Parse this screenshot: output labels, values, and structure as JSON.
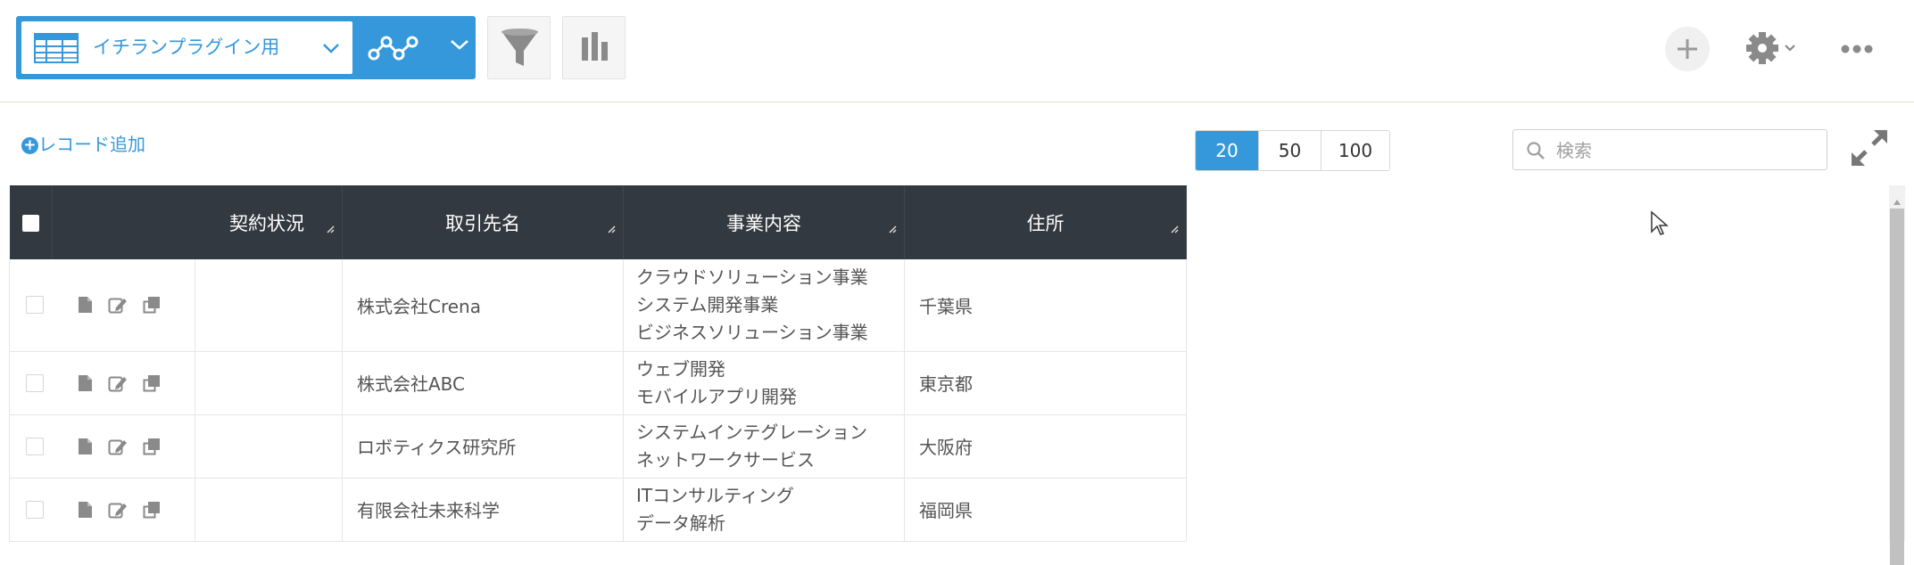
{
  "header": {
    "view_name": "イチランプラグイン用",
    "icons": [
      "table-icon",
      "chevron-down-icon",
      "graph-line-icon",
      "filter-icon",
      "bar-chart-icon",
      "plus-icon",
      "gear-icon",
      "more-icon"
    ]
  },
  "toolbar": {
    "add_record_label": "レコード追加",
    "page_sizes": [
      "20",
      "50",
      "100"
    ],
    "active_page_size": "20",
    "search_placeholder": "検索"
  },
  "table": {
    "columns": [
      "契約状況",
      "取引先名",
      "事業内容",
      "住所"
    ],
    "rows": [
      {
        "status": "",
        "company": "株式会社Crena",
        "business": [
          "クラウドソリューション事業",
          "システム開発事業",
          "ビジネスソリューション事業"
        ],
        "address": "千葉県"
      },
      {
        "status": "",
        "company": "株式会社ABC",
        "business": [
          "ウェブ開発",
          "モバイルアプリ開発"
        ],
        "address": "東京都"
      },
      {
        "status": "",
        "company": "ロボティクス研究所",
        "business": [
          "システムインテグレーション",
          "ネットワークサービス"
        ],
        "address": "大阪府"
      },
      {
        "status": "",
        "company": "有限会社未来科学",
        "business": [
          "ITコンサルティング",
          "データ解析"
        ],
        "address": "福岡県"
      }
    ]
  },
  "colors": {
    "accent": "#3498db",
    "header_bg": "#333940",
    "icon_gray": "#8a8a8a"
  }
}
